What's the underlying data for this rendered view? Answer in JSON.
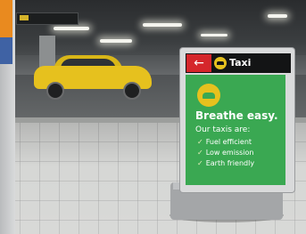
{
  "sign": {
    "header_arrow": "←",
    "header_label": "Taxi",
    "headline": "Breathe easy.",
    "subhead": "Our taxis are:",
    "bullets": [
      "Fuel efficient",
      "Low emission",
      "Earth friendly"
    ],
    "bullet_icon": "check-icon"
  },
  "colors": {
    "taxi_yellow": "#e6c11e",
    "sign_green": "#3aa852",
    "arrow_red": "#d5262b",
    "header_black": "#131415"
  }
}
